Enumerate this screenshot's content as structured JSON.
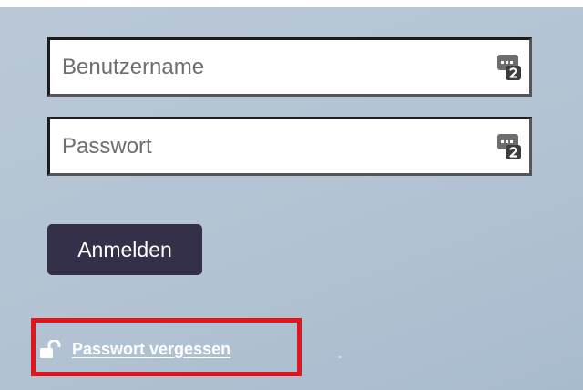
{
  "login_form": {
    "username": {
      "placeholder": "Benutzername",
      "value": "",
      "icon": "password-manager-key-icon"
    },
    "password": {
      "placeholder": "Passwort",
      "value": "",
      "icon": "password-manager-key-icon"
    },
    "submit_label": "Anmelden",
    "forgot_password": {
      "label": "Passwort vergessen",
      "icon": "unlock-icon",
      "highlight_color": "#e3141e"
    }
  },
  "colors": {
    "background": "#b3c3d3",
    "button_background": "#34304a",
    "button_text": "#ffffff",
    "link_text": "#ffffff"
  }
}
